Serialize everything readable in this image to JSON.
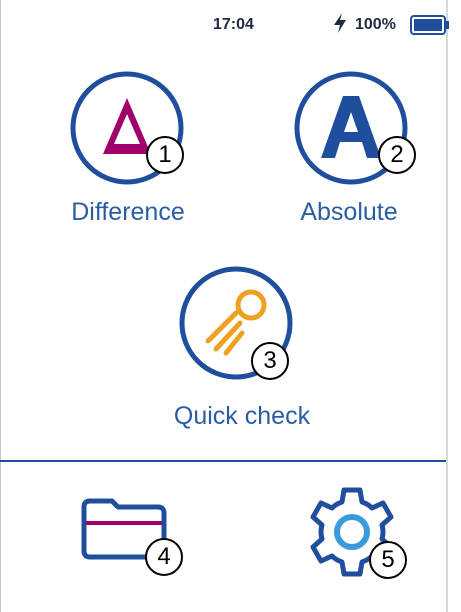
{
  "status": {
    "time": "17:04",
    "battery": "100%"
  },
  "modes": {
    "difference": {
      "label": "Difference",
      "badge": "1"
    },
    "absolute": {
      "label": "Absolute",
      "badge": "2"
    },
    "quick": {
      "label": "Quick check",
      "badge": "3"
    }
  },
  "bottom": {
    "files": {
      "badge": "4"
    },
    "settings": {
      "badge": "5"
    }
  },
  "colors": {
    "primary": "#1f4f9c",
    "accent_magenta": "#a0006a",
    "accent_orange": "#f0a020",
    "accent_blue": "#3a9bdc"
  }
}
